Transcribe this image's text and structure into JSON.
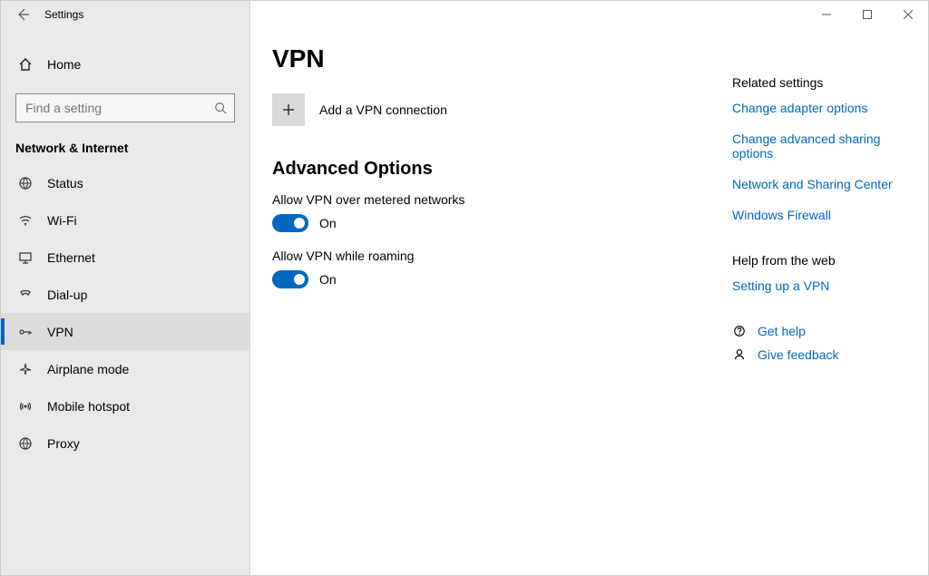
{
  "titlebar": {
    "title": "Settings"
  },
  "sidebar": {
    "home": "Home",
    "search_placeholder": "Find a setting",
    "category": "Network & Internet",
    "items": [
      {
        "label": "Status"
      },
      {
        "label": "Wi-Fi"
      },
      {
        "label": "Ethernet"
      },
      {
        "label": "Dial-up"
      },
      {
        "label": "VPN"
      },
      {
        "label": "Airplane mode"
      },
      {
        "label": "Mobile hotspot"
      },
      {
        "label": "Proxy"
      }
    ]
  },
  "main": {
    "heading": "VPN",
    "add_connection": "Add a VPN connection",
    "advanced_heading": "Advanced Options",
    "toggles": [
      {
        "label": "Allow VPN over metered networks",
        "state": "On"
      },
      {
        "label": "Allow VPN while roaming",
        "state": "On"
      }
    ]
  },
  "side": {
    "related_heading": "Related settings",
    "related_links": [
      "Change adapter options",
      "Change advanced sharing options",
      "Network and Sharing Center",
      "Windows Firewall"
    ],
    "help_heading": "Help from the web",
    "help_links": [
      "Setting up a VPN"
    ],
    "actions": {
      "get_help": "Get help",
      "give_feedback": "Give feedback"
    }
  }
}
